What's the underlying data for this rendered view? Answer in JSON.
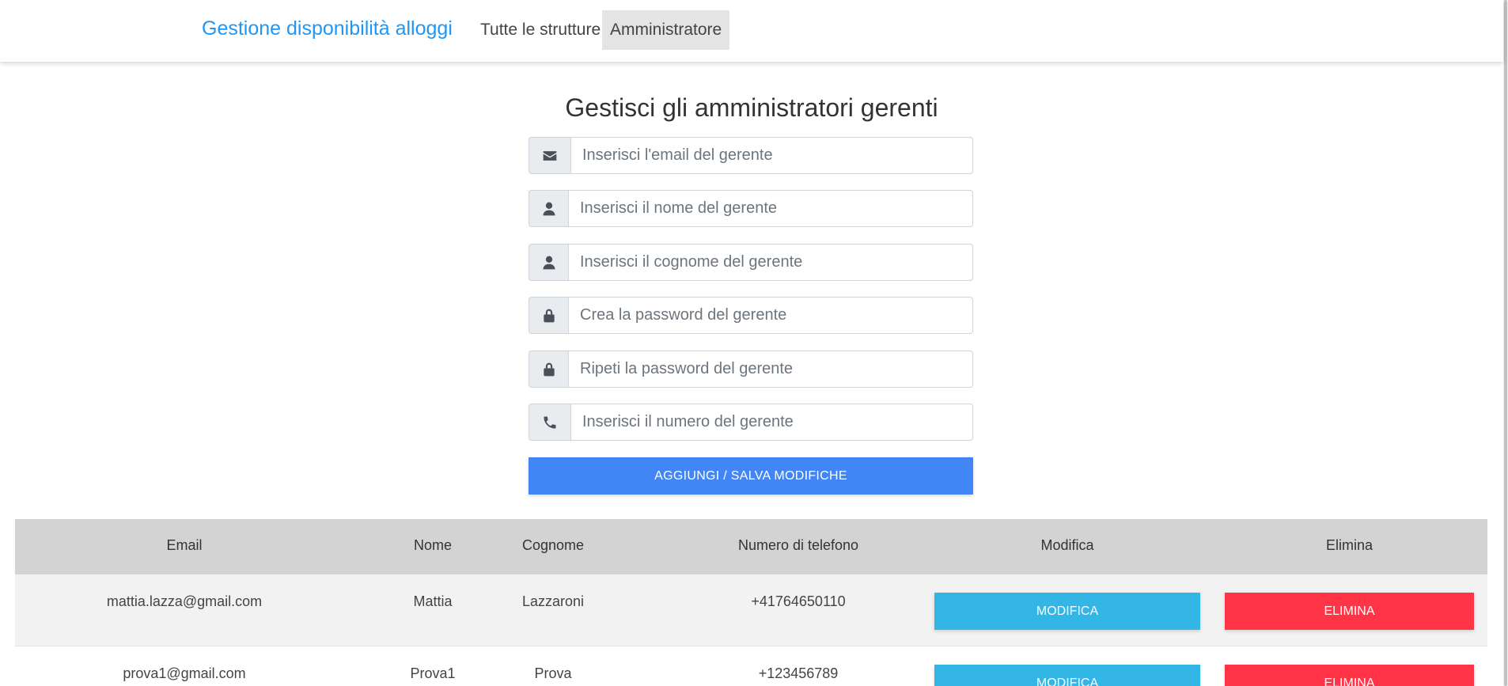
{
  "navbar": {
    "brand": "Gestione disponibilità alloggi",
    "links": [
      "Tutte le strutture",
      "Amministratore"
    ]
  },
  "page_title": "Gestisci gli amministratori gerenti",
  "form": {
    "email_placeholder": "Inserisci l'email del gerente",
    "name_placeholder": "Inserisci il nome del gerente",
    "surname_placeholder": "Inserisci il cognome del gerente",
    "password_placeholder": "Crea la password del gerente",
    "password_repeat_placeholder": "Ripeti la password del gerente",
    "phone_placeholder": "Inserisci il numero del gerente",
    "submit_label": "AGGIUNGI / SALVA MODIFICHE",
    "icons": [
      "envelope-icon",
      "user-icon",
      "user-icon",
      "lock-icon",
      "lock-icon",
      "phone-icon"
    ]
  },
  "table": {
    "headers": [
      "Email",
      "Nome",
      "Cognome",
      "Numero di telefono",
      "Modifica",
      "Elimina"
    ],
    "rows": [
      {
        "email": "mattia.lazza@gmail.com",
        "nome": "Mattia",
        "cognome": "Lazzaroni",
        "telefono": "+41764650110",
        "modifica": "MODIFICA",
        "elimina": "ELIMINA"
      },
      {
        "email": "prova1@gmail.com",
        "nome": "Prova1",
        "cognome": "Prova",
        "telefono": "+123456789",
        "modifica": "MODIFICA",
        "elimina": "ELIMINA"
      }
    ]
  },
  "colors": {
    "brand": "#2196f3",
    "primary_button": "#4285f4",
    "info_button": "#33b5e5",
    "danger_button": "#ff3547",
    "table_header": "#d3d3d3"
  }
}
